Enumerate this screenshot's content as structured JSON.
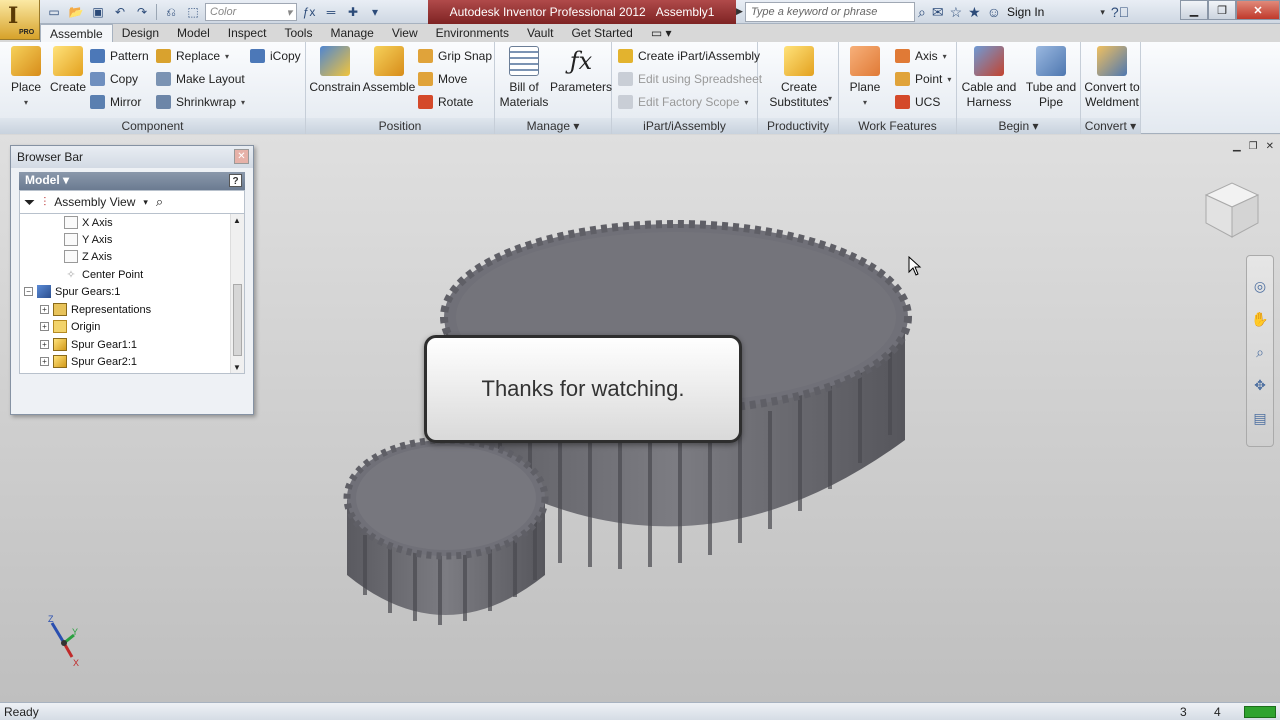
{
  "title_bar": {
    "color_placeholder": "Color",
    "app_title": "Autodesk Inventor Professional 2012",
    "document": "Assembly1",
    "search_placeholder": "Type a keyword or phrase",
    "sign_in": "Sign In",
    "app_logo": "I",
    "app_edition": "PRO"
  },
  "tabs": [
    "Assemble",
    "Design",
    "Model",
    "Inspect",
    "Tools",
    "Manage",
    "View",
    "Environments",
    "Vault",
    "Get Started"
  ],
  "ribbon": {
    "component": {
      "label": "Component",
      "place": "Place",
      "create": "Create",
      "pattern": "Pattern",
      "copy": "Copy",
      "mirror": "Mirror",
      "replace": "Replace",
      "make_layout": "Make Layout",
      "shrinkwrap": "Shrinkwrap",
      "icopy": "iCopy"
    },
    "position": {
      "label": "Position",
      "constrain": "Constrain",
      "assemble": "Assemble",
      "grip_snap": "Grip Snap",
      "move": "Move",
      "rotate": "Rotate"
    },
    "manage": {
      "label": "Manage",
      "bom_line1": "Bill of",
      "bom_line2": "Materials",
      "parameters": "Parameters"
    },
    "ipart": {
      "label": "iPart/iAssembly",
      "create": "Create iPart/iAssembly",
      "edit_spreadsheet": "Edit using Spreadsheet",
      "edit_factory": "Edit Factory Scope"
    },
    "productivity": {
      "label": "Productivity",
      "line1": "Create",
      "line2": "Substitutes"
    },
    "work_features": {
      "label": "Work Features",
      "plane": "Plane",
      "axis": "Axis",
      "point": "Point",
      "ucs": "UCS"
    },
    "begin": {
      "label": "Begin",
      "cable_line1": "Cable and",
      "cable_line2": "Harness",
      "tube_line1": "Tube and",
      "tube_line2": "Pipe"
    },
    "convert": {
      "label": "Convert",
      "line1": "Convert to",
      "line2": "Weldment"
    }
  },
  "browser": {
    "title": "Browser Bar",
    "model_label": "Model",
    "help": "?",
    "view_mode": "Assembly View",
    "tree": [
      {
        "label": "X Axis",
        "icon": "axis-icon"
      },
      {
        "label": "Y Axis",
        "icon": "axis-icon"
      },
      {
        "label": "Z Axis",
        "icon": "axis-icon"
      },
      {
        "label": "Center Point",
        "icon": "point-icon"
      },
      {
        "label": "Spur Gears:1",
        "icon": "gear-component-icon"
      },
      {
        "label": "Representations",
        "icon": "representations-icon"
      },
      {
        "label": "Origin",
        "icon": "folder-icon"
      },
      {
        "label": "Spur Gear1:1",
        "icon": "part-icon"
      },
      {
        "label": "Spur Gear2:1",
        "icon": "part-icon"
      }
    ]
  },
  "viewport": {
    "callout_text": "Thanks for watching.",
    "triad": {
      "x": "X",
      "y": "Y",
      "z": "Z"
    }
  },
  "status_bar": {
    "status": "Ready",
    "count1": "3",
    "count2": "4"
  },
  "colors": {
    "title_accent": "#7e2323",
    "gear": "#6e6e74",
    "status_ok": "#2fa32f"
  }
}
